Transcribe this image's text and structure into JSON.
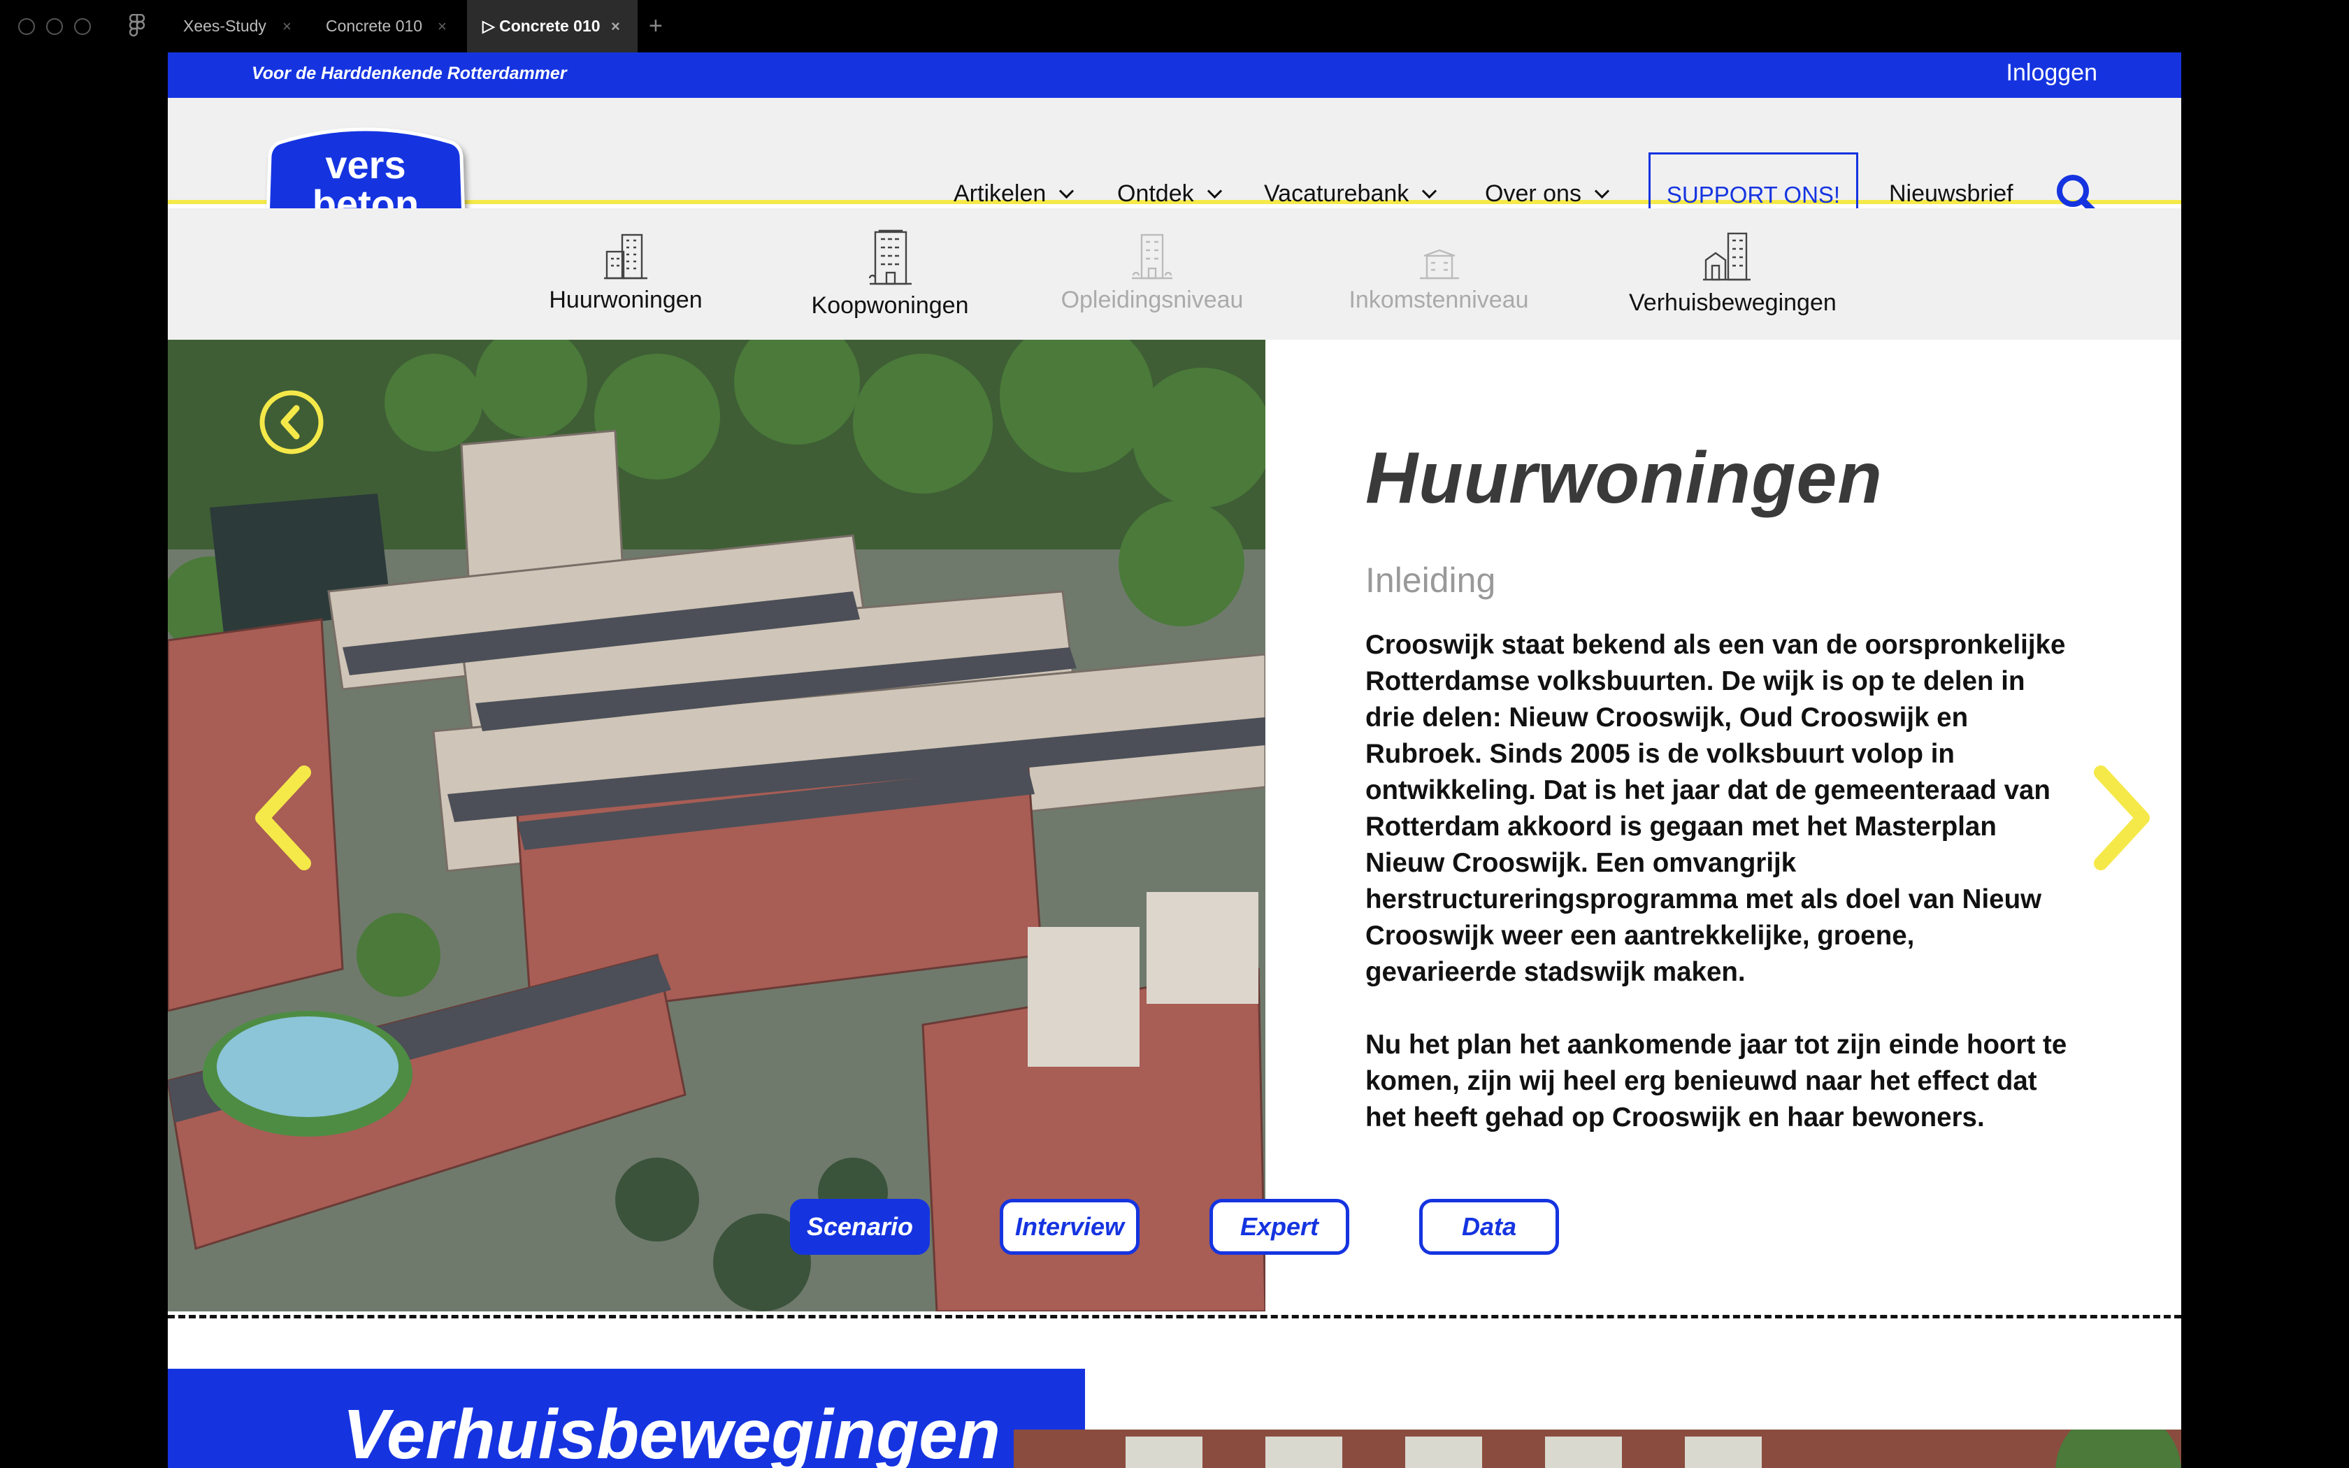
{
  "tabbar": {
    "tabs": [
      {
        "label": "Xees-Study"
      },
      {
        "label": "Concrete 010"
      },
      {
        "label": "Concrete 010",
        "active_prefix": "▷"
      }
    ],
    "close": "×",
    "add": "+"
  },
  "site": {
    "tagline": "Voor de Harddenkende Rotterdammer",
    "login": "Inloggen",
    "logo": {
      "line1": "vers",
      "line2": "beton"
    },
    "brand_color": "#1534e0",
    "accent_color": "#f5e94a"
  },
  "nav": {
    "items": [
      "Artikelen",
      "Ontdek",
      "Vacaturebank",
      "Over ons"
    ],
    "support": "SUPPORT ONS!",
    "newsletter": "Nieuwsbrief"
  },
  "subnav": {
    "items": [
      {
        "label": "Huurwoningen",
        "icon": "apartment-buildings-icon",
        "dim": false
      },
      {
        "label": "Koopwoningen",
        "icon": "tower-building-icon",
        "dim": false
      },
      {
        "label": "Opleidingsniveau",
        "icon": "school-building-icon",
        "dim": true
      },
      {
        "label": "Inkomstenniveau",
        "icon": "low-building-icon",
        "dim": true
      },
      {
        "label": "Verhuisbewegingen",
        "icon": "city-houses-icon",
        "dim": false
      }
    ]
  },
  "article": {
    "title": "Huurwoningen",
    "subtitle": "Inleiding",
    "paragraphs": [
      "Crooswijk staat bekend als een van de oorspronkelijke Rotterdamse volksbuurten. De wijk is op te delen in drie delen: Nieuw Crooswijk, Oud Crooswijk en Rubroek. Sinds 2005 is de volksbuurt volop in ontwikkeling. Dat is het jaar dat de gemeenteraad van Rotterdam akkoord is gegaan met het Masterplan Nieuw Crooswijk. Een omvangrijk herstructureringsprogramma met als doel van Nieuw Crooswijk weer een aantrekkelijke, groene, gevarieerde stadswijk maken.",
      "Nu het plan het aankomende jaar tot zijn einde hoort te komen, zijn wij heel erg benieuwd naar het effect dat het heeft gehad op Crooswijk en haar bewoners."
    ],
    "tags": [
      {
        "label": "Scenario",
        "active": true
      },
      {
        "label": "Interview",
        "active": false
      },
      {
        "label": "Expert",
        "active": false
      },
      {
        "label": "Data",
        "active": false
      }
    ]
  },
  "next_section": {
    "title": "Verhuisbewegingen"
  }
}
